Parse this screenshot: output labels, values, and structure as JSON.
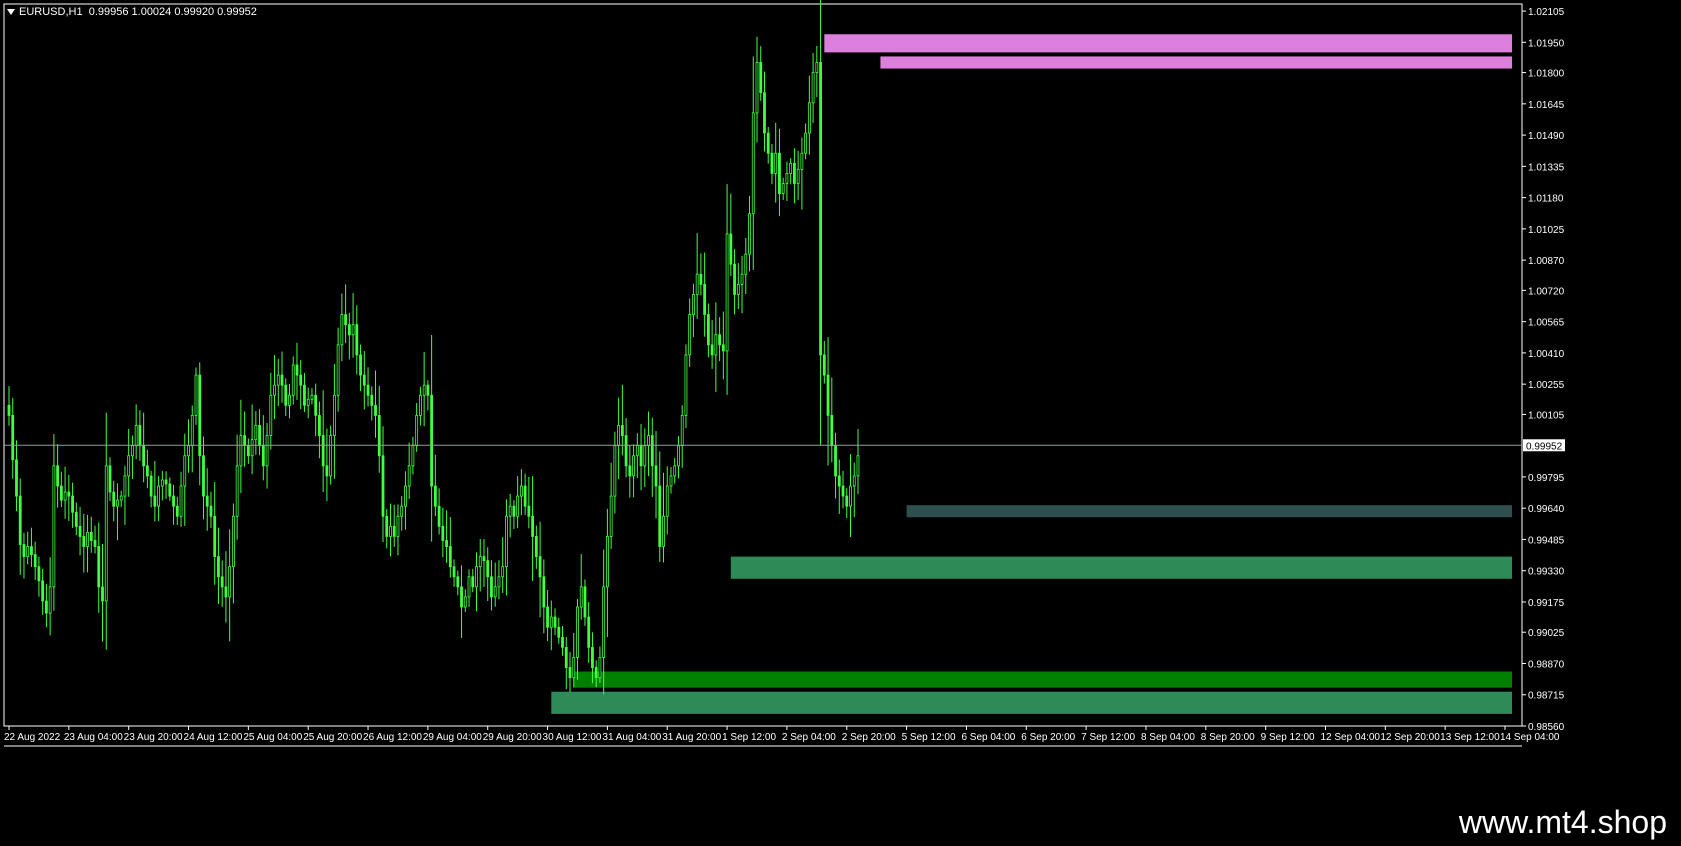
{
  "header": {
    "symbol": "EURUSD,H1",
    "ohlc": "0.99956 1.00024 0.99920 0.99952"
  },
  "watermark": "www.mt4.shop",
  "colors": {
    "background": "#000000",
    "frame": "#ffffff",
    "candle": "#40ff40",
    "price_line": "#8fa0a0",
    "supply_zone": "#dd7fdd",
    "demand_zone": "#2e8b57",
    "demand_zone_strong": "#008000",
    "small_zone": "#2f4f4f"
  },
  "chart_data": {
    "type": "candlestick",
    "symbol": "EURUSD",
    "timeframe": "H1",
    "ylim": [
      0.9856,
      1.0214
    ],
    "y_ticks": [
      1.02105,
      1.0195,
      1.018,
      1.01645,
      1.0149,
      1.01335,
      1.0118,
      1.01025,
      1.0087,
      1.0072,
      1.00565,
      1.0041,
      1.00255,
      1.00105,
      0.99795,
      0.9964,
      0.99485,
      0.9933,
      0.99175,
      0.99025,
      0.9887,
      0.98715,
      0.9856
    ],
    "y_tick_labels": [
      "1.02105",
      "1.01950",
      "1.01800",
      "1.01645",
      "1.01490",
      "1.01335",
      "1.01180",
      "1.01025",
      "1.00870",
      "1.00720",
      "1.00565",
      "1.00410",
      "1.00255",
      "1.00105",
      "0.99795",
      "0.99640",
      "0.99485",
      "0.99330",
      "0.99175",
      "0.99025",
      "0.98870",
      "0.98715",
      "0.98560"
    ],
    "current_price": 0.99952,
    "current_price_label": "0.99952",
    "x_tick_labels": [
      "22 Aug 2022",
      "23 Aug 04:00",
      "23 Aug 20:00",
      "24 Aug 12:00",
      "25 Aug 04:00",
      "25 Aug 20:00",
      "26 Aug 12:00",
      "29 Aug 04:00",
      "29 Aug 20:00",
      "30 Aug 12:00",
      "31 Aug 04:00",
      "31 Aug 20:00",
      "1 Sep 12:00",
      "2 Sep 04:00",
      "2 Sep 20:00",
      "5 Sep 12:00",
      "6 Sep 04:00",
      "6 Sep 20:00",
      "7 Sep 12:00",
      "8 Sep 04:00",
      "8 Sep 20:00",
      "9 Sep 12:00",
      "12 Sep 04:00",
      "12 Sep 20:00",
      "13 Sep 12:00",
      "14 Sep 04:00"
    ],
    "bars_per_x_tick": 16,
    "closes": [
      1.001,
      0.9988,
      0.997,
      0.9946,
      0.994,
      0.9945,
      0.9941,
      0.9935,
      0.9928,
      0.9918,
      0.9912,
      0.9925,
      0.9985,
      0.9975,
      0.9968,
      0.9972,
      0.997,
      0.9962,
      0.9955,
      0.995,
      0.9945,
      0.9952,
      0.9948,
      0.9945,
      0.9925,
      0.9918,
      0.9985,
      0.9972,
      0.9965,
      0.9968,
      0.997,
      0.998,
      0.999,
      0.9995,
      1.0005,
      0.9995,
      0.9985,
      0.998,
      0.997,
      0.9965,
      0.9975,
      0.9978,
      0.9976,
      0.997,
      0.9965,
      0.996,
      0.9975,
      0.999,
      0.9995,
      1.001,
      1.003,
      0.999,
      0.997,
      0.9965,
      0.996,
      0.994,
      0.993,
      0.9925,
      0.992,
      0.9935,
      0.996,
      0.9985,
      1.0,
      0.9995,
      0.999,
      0.9998,
      1.0005,
      0.9995,
      0.9985,
      1.0,
      1.002,
      1.0025,
      1.003,
      1.0025,
      1.0015,
      1.002,
      1.0035,
      1.003,
      1.0025,
      1.0015,
      1.0018,
      1.002,
      1.001,
      1.0,
      0.9985,
      0.998,
      1.0,
      1.002,
      1.0045,
      1.006,
      1.0055,
      1.005,
      1.0055,
      1.004,
      1.003,
      1.0025,
      1.002,
      1.0015,
      1.001,
      0.999,
      0.996,
      0.995,
      0.9955,
      0.995,
      0.996,
      0.9965,
      0.9975,
      0.9985,
      0.9995,
      1.001,
      1.002,
      1.0025,
      1.002,
      0.9975,
      0.9965,
      0.9955,
      0.9948,
      0.9945,
      0.9935,
      0.993,
      0.9925,
      0.9915,
      0.992,
      0.993,
      0.9925,
      0.9935,
      0.994,
      0.9938,
      0.993,
      0.992,
      0.9925,
      0.993,
      0.9935,
      0.996,
      0.9965,
      0.996,
      0.997,
      0.9975,
      0.9965,
      0.996,
      0.995,
      0.994,
      0.993,
      0.9915,
      0.9905,
      0.991,
      0.9905,
      0.99,
      0.9895,
      0.9885,
      0.988,
      0.989,
      0.9915,
      0.9925,
      0.991,
      0.9895,
      0.9885,
      0.988,
      0.989,
      0.9925,
      0.995,
      0.997,
      0.9995,
      1.0005,
      1.0,
      0.9985,
      0.998,
      0.999,
      0.9995,
      0.9985,
      0.9995,
      1.0,
      0.9985,
      0.9975,
      0.9945,
      0.996,
      0.9975,
      0.998,
      0.9985,
      0.9995,
      1.001,
      1.004,
      1.006,
      1.007,
      1.008,
      1.0075,
      1.006,
      1.0045,
      1.004,
      1.005,
      1.0045,
      1.0042,
      1.01,
      1.0085,
      1.007,
      1.0075,
      1.008,
      1.009,
      1.011,
      1.016,
      1.0185,
      1.017,
      1.015,
      1.014,
      1.013,
      1.014,
      1.012,
      1.0125,
      1.013,
      1.0135,
      1.0125,
      1.0132,
      1.014,
      1.015,
      1.0165,
      1.018,
      1.0185,
      1.004,
      1.003,
      1.001,
      0.9995,
      0.998,
      0.9975,
      0.997,
      0.9965,
      0.9975,
      0.998,
      0.999
    ],
    "zones": [
      {
        "kind": "supply",
        "from_bar": 218,
        "y_top": 1.0199,
        "y_bottom": 1.019
      },
      {
        "kind": "supply",
        "from_bar": 233,
        "y_top": 1.0188,
        "y_bottom": 1.0182
      },
      {
        "kind": "demand",
        "from_bar": 240,
        "y_top": 0.99655,
        "y_bottom": 0.99595
      },
      {
        "kind": "demand",
        "from_bar": 193,
        "y_top": 0.994,
        "y_bottom": 0.9929
      },
      {
        "kind": "demand_strong",
        "from_bar": 151,
        "y_top": 0.9883,
        "y_bottom": 0.9875
      },
      {
        "kind": "demand",
        "from_bar": 145,
        "y_top": 0.9873,
        "y_bottom": 0.9862
      }
    ]
  }
}
